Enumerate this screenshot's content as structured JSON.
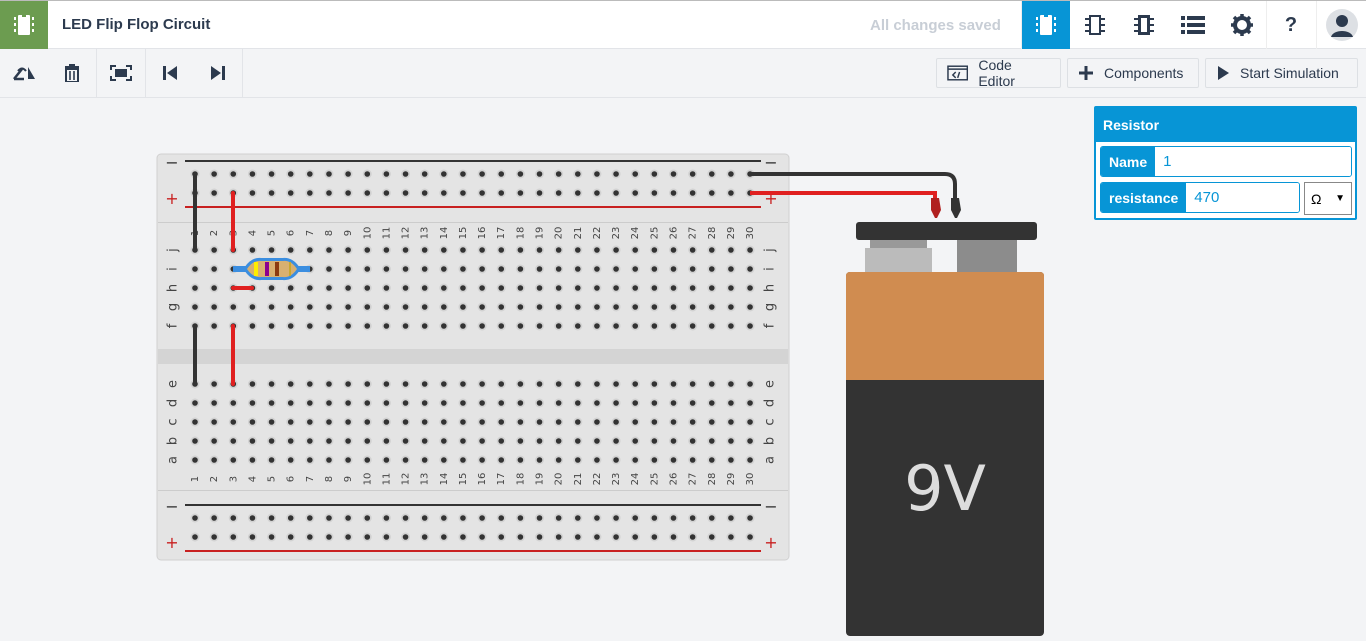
{
  "app": {
    "title": "LED Flip Flop Circuit",
    "save_status": "All changes saved",
    "brand_color": "#6c9c50",
    "accent_color": "#0795d6"
  },
  "topbar_icons": [
    "circuit-view-icon",
    "schematic-icon",
    "component-list-icon",
    "list-icon",
    "gear-icon",
    "help-icon",
    "user-avatar-icon"
  ],
  "help_label": "?",
  "toolbar": {
    "rotate": "rotate-icon",
    "delete": "trash-icon",
    "fit": "fit-view-icon",
    "prev": "step-back-icon",
    "next": "step-forward-icon",
    "code_editor": "Code Editor",
    "components": "Components",
    "start_simulation": "Start Simulation"
  },
  "inspector": {
    "title": "Resistor",
    "name_label": "Name",
    "name_value": "1",
    "resistance_label": "resistance",
    "resistance_value": "470",
    "unit": "Ω"
  },
  "breadboard": {
    "columns": 30,
    "top_rows": [
      "j",
      "i",
      "h",
      "g",
      "f"
    ],
    "bottom_rows": [
      "e",
      "d",
      "c",
      "b",
      "a"
    ],
    "rail_minus": "−",
    "rail_plus": "+"
  },
  "battery": {
    "label": "9V"
  },
  "resistor_bands": [
    "#ffee00",
    "#8b0090",
    "#8b3a10",
    "#c8a830"
  ]
}
